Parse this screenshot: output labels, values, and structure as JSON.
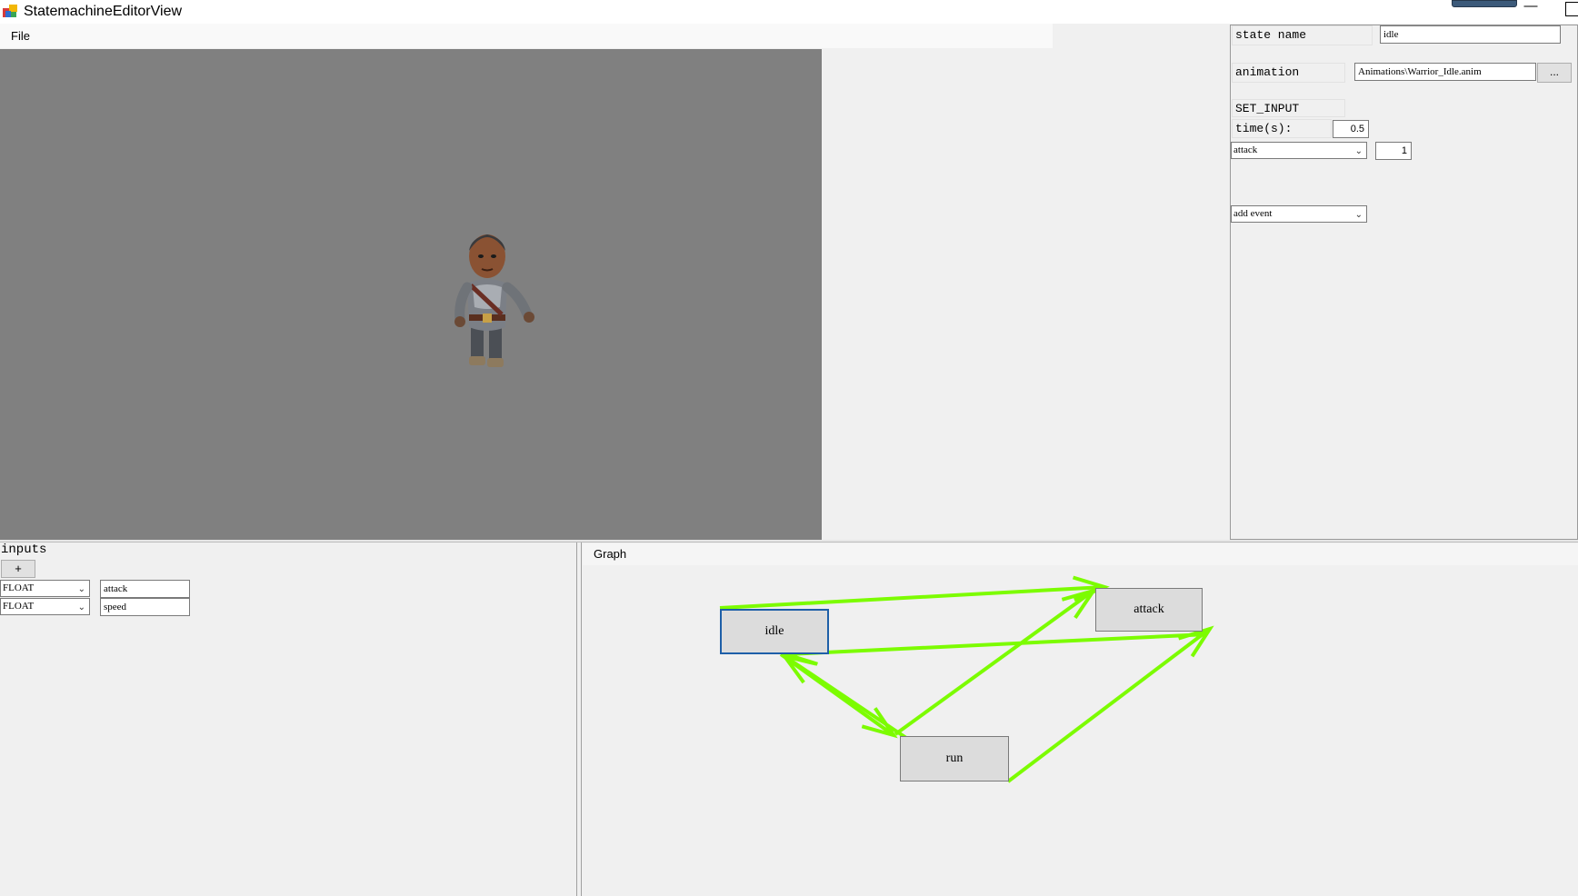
{
  "window": {
    "title": "StatemachineEditorView",
    "minimize_glyph": "—"
  },
  "menu": {
    "items": [
      "File"
    ]
  },
  "viewport": {
    "background": "#808080",
    "content": "warrior-character-model"
  },
  "properties": {
    "state_name_label": "state name",
    "state_name_value": "idle",
    "animation_label": "animation",
    "animation_value": "Animations\\Warrior_Idle.anim",
    "browse_button": "...",
    "event_type_label": "SET_INPUT",
    "time_label": "time(s):",
    "time_value": "0.5",
    "input_select_value": "attack",
    "input_value": "1",
    "add_event_select_value": "add event"
  },
  "inputs": {
    "title": "inputs",
    "add_button": "+",
    "rows": [
      {
        "type": "FLOAT",
        "name": "attack"
      },
      {
        "type": "FLOAT",
        "name": "speed"
      }
    ]
  },
  "graph": {
    "title": "Graph",
    "edge_color": "#7cfc00",
    "selected_color": "#1e5fa8",
    "nodes": [
      {
        "id": "idle",
        "label": "idle",
        "selected": true
      },
      {
        "id": "attack",
        "label": "attack",
        "selected": false
      },
      {
        "id": "run",
        "label": "run",
        "selected": false
      }
    ],
    "edges": [
      {
        "from": "idle",
        "to": "attack"
      },
      {
        "from": "idle",
        "to": "run"
      },
      {
        "from": "run",
        "to": "idle"
      },
      {
        "from": "run",
        "to": "attack"
      },
      {
        "from": "attack",
        "to": "idle"
      },
      {
        "from": "attack",
        "to": "run"
      }
    ]
  }
}
